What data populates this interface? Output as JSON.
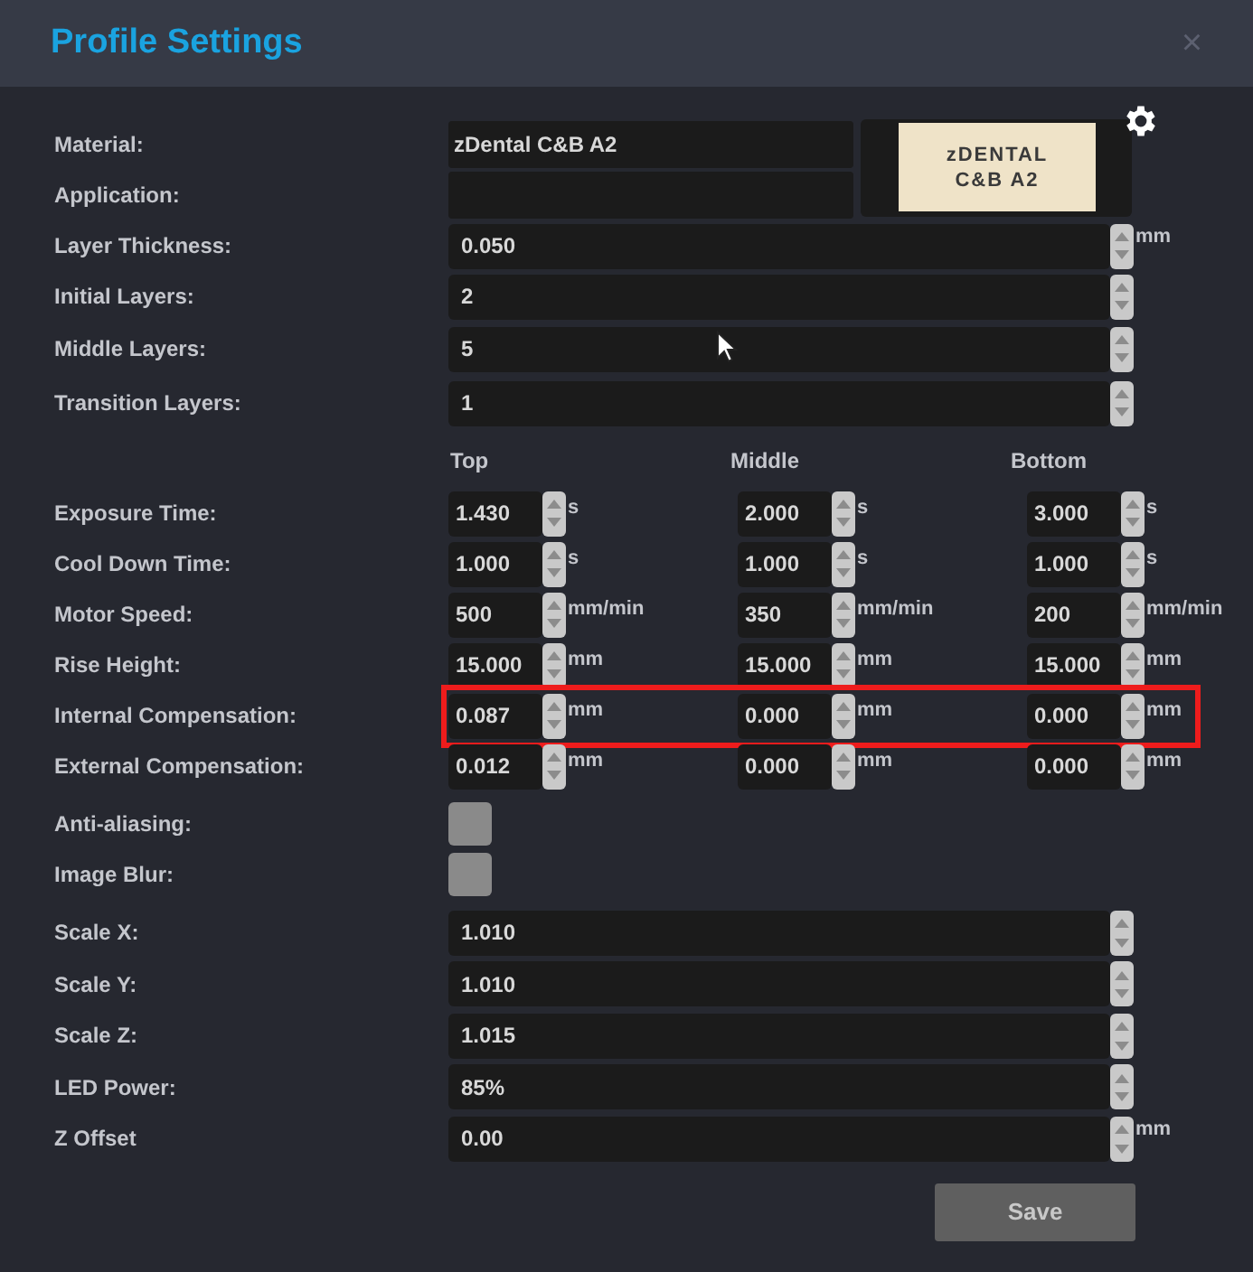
{
  "window": {
    "title": "Profile Settings",
    "close": "×"
  },
  "material": {
    "label": "Material:",
    "value": "zDental C&B A2"
  },
  "application": {
    "label": "Application:"
  },
  "material_label": {
    "lines": [
      "zDENTAL",
      "C&B A2"
    ]
  },
  "fields_top": [
    {
      "label": "Layer Thickness:",
      "value": "0.050",
      "unit": "mm"
    },
    {
      "label": "Initial Layers:",
      "value": "2"
    },
    {
      "label": "Middle Layers:",
      "value": "5"
    },
    {
      "label": "Transition Layers:",
      "value": "1"
    }
  ],
  "columns": [
    "Top",
    "Middle",
    "Bottom"
  ],
  "rows": [
    {
      "label": "Exposure Time:",
      "values": [
        {
          "value": "1.430",
          "unit": "s"
        },
        {
          "value": "2.000",
          "unit": "s"
        },
        {
          "value": "3.000",
          "unit": "s"
        }
      ],
      "highlighted": false
    },
    {
      "label": "Cool Down Time:",
      "values": [
        {
          "value": "1.000",
          "unit": "s"
        },
        {
          "value": "1.000",
          "unit": "s"
        },
        {
          "value": "1.000",
          "unit": "s"
        }
      ],
      "highlighted": false
    },
    {
      "label": "Motor Speed:",
      "values": [
        {
          "value": "500",
          "unit": "mm/min"
        },
        {
          "value": "350",
          "unit": "mm/min"
        },
        {
          "value": "200",
          "unit": "mm/min"
        }
      ],
      "highlighted": false
    },
    {
      "label": "Rise Height:",
      "values": [
        {
          "value": "15.000",
          "unit": "mm"
        },
        {
          "value": "15.000",
          "unit": "mm"
        },
        {
          "value": "15.000",
          "unit": "mm"
        }
      ],
      "highlighted": false
    },
    {
      "label": "Internal Compensation:",
      "values": [
        {
          "value": "0.087",
          "unit": "mm"
        },
        {
          "value": "0.000",
          "unit": "mm"
        },
        {
          "value": "0.000",
          "unit": "mm"
        }
      ],
      "highlighted": true
    },
    {
      "label": "External Compensation:",
      "values": [
        {
          "value": "0.012",
          "unit": "mm"
        },
        {
          "value": "0.000",
          "unit": "mm"
        },
        {
          "value": "0.000",
          "unit": "mm"
        }
      ],
      "highlighted": false
    }
  ],
  "checkboxes": [
    {
      "label": "Anti-aliasing:",
      "checked": false
    },
    {
      "label": "Image Blur:",
      "checked": false
    }
  ],
  "fields_bottom": [
    {
      "label": "Scale X:",
      "value": "1.010"
    },
    {
      "label": "Scale Y:",
      "value": "1.010"
    },
    {
      "label": "Scale Z:",
      "value": "1.015"
    },
    {
      "label": "LED Power:",
      "value": "85%"
    },
    {
      "label": "Z Offset",
      "value": "0.00",
      "unit": "mm"
    }
  ],
  "save_button": "Save"
}
